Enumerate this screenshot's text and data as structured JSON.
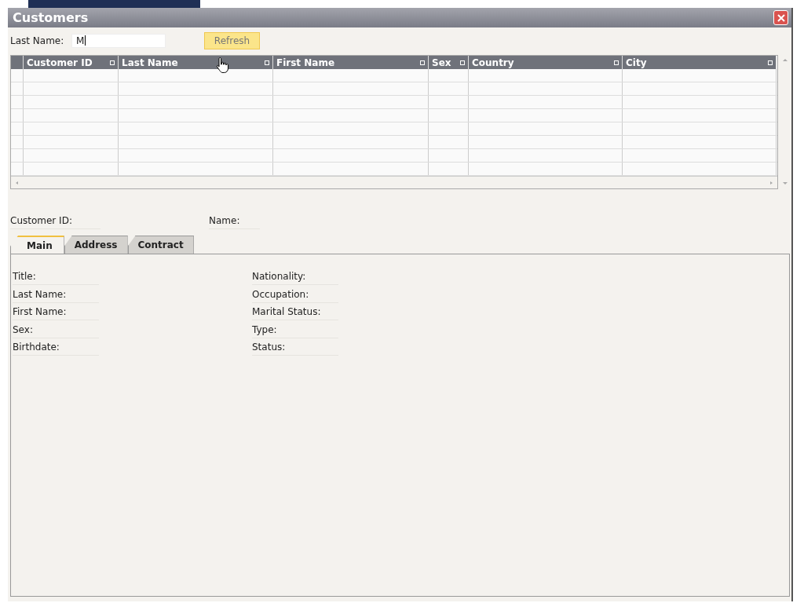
{
  "window": {
    "title": "Customers"
  },
  "filter": {
    "label": "Last Name:",
    "value": "M",
    "button": "Refresh"
  },
  "grid": {
    "columns": [
      {
        "label": "Customer ID"
      },
      {
        "label": "Last Name"
      },
      {
        "label": "First Name"
      },
      {
        "label": "Sex"
      },
      {
        "label": "Country"
      },
      {
        "label": "City"
      }
    ]
  },
  "header_fields": [
    {
      "label": "Customer ID:"
    },
    {
      "label": "Name:"
    }
  ],
  "tabs": [
    {
      "label": "Main",
      "selected": true
    },
    {
      "label": "Address",
      "selected": false
    },
    {
      "label": "Contract",
      "selected": false
    }
  ],
  "fields_left": [
    {
      "label": "Title:"
    },
    {
      "label": "Last Name:"
    },
    {
      "label": "First Name:"
    },
    {
      "label": "Sex:"
    },
    {
      "label": "Birthdate:"
    }
  ],
  "fields_right": [
    {
      "label": "Nationality:"
    },
    {
      "label": "Occupation:"
    },
    {
      "label": "Marital Status:"
    },
    {
      "label": "Type:"
    },
    {
      "label": "Status:"
    }
  ]
}
